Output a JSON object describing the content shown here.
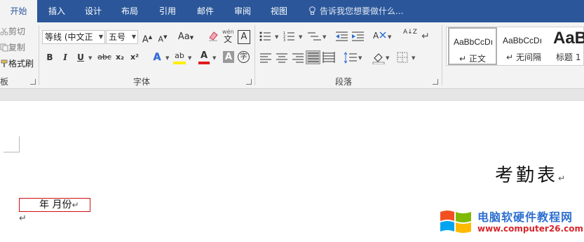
{
  "tabs": [
    "开始",
    "插入",
    "设计",
    "布局",
    "引用",
    "邮件",
    "审阅",
    "视图"
  ],
  "tell_me": "告诉我您想要做什么...",
  "clipboard": {
    "cut": "剪切",
    "copy": "复制",
    "format_painter": "格式刷",
    "group_label": "板"
  },
  "font": {
    "name": "等线 (中文正",
    "size": "五号",
    "grow": "A",
    "shrink": "A",
    "case": "Aa",
    "phonetic_top": "wén",
    "phonetic_bottom": "文",
    "char_border": "A",
    "bold": "B",
    "italic": "I",
    "underline": "U",
    "strike": "abc",
    "subscript": "x₂",
    "superscript": "x²",
    "text_effects": "A",
    "highlight": "ab",
    "font_color": "A",
    "shading": "A",
    "enclose": "字",
    "group_label": "字体"
  },
  "paragraph": {
    "group_label": "段落",
    "sort_icon": "A↓Z"
  },
  "styles": [
    {
      "sample": "AaBbCcDı",
      "name": "正文",
      "marker": "↵"
    },
    {
      "sample": "AaBbCcDı",
      "name": "无间隔",
      "marker": "↵"
    },
    {
      "sample": "AaB",
      "name": "标题 1",
      "marker": ""
    }
  ],
  "document": {
    "title": "考勤表",
    "paragraph_mark": "↵",
    "month_line": "年   月份",
    "empty_para": "↵"
  },
  "watermark": {
    "title": "电脑软硬件教程网",
    "url": "www.computer26.com"
  },
  "colors": {
    "tab_bar": "#2b579a",
    "ribbon": "#f3f3f3",
    "highlight_yellow": "#ffee00",
    "font_color_red": "#e21a1a",
    "selection_box": "#d01010"
  }
}
